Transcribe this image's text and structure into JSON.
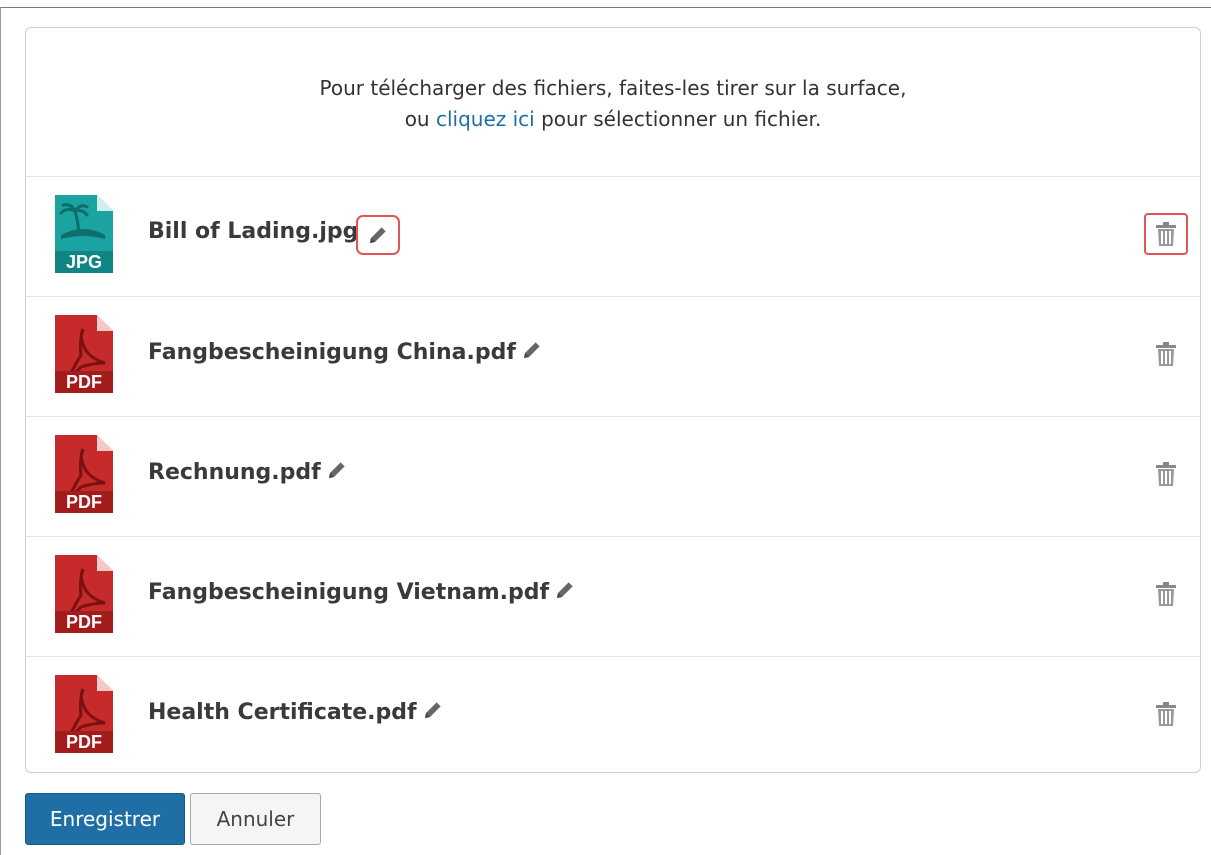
{
  "dropzone": {
    "line1": "Pour télécharger des fichiers, faites-les tirer sur la surface,",
    "line2_prefix": "ou ",
    "line2_link": "cliquez ici",
    "line2_suffix": " pour sélectionner un fichier."
  },
  "files": [
    {
      "name": "Bill of Lading.jpg",
      "type_label": "JPG",
      "icon": "jpg-file-icon",
      "highlighted": true
    },
    {
      "name": "Fangbescheinigung China.pdf",
      "type_label": "PDF",
      "icon": "pdf-file-icon",
      "highlighted": false
    },
    {
      "name": "Rechnung.pdf",
      "type_label": "PDF",
      "icon": "pdf-file-icon",
      "highlighted": false
    },
    {
      "name": "Fangbescheinigung Vietnam.pdf",
      "type_label": "PDF",
      "icon": "pdf-file-icon",
      "highlighted": false
    },
    {
      "name": "Health Certificate.pdf",
      "type_label": "PDF",
      "icon": "pdf-file-icon",
      "highlighted": false
    }
  ],
  "actions": {
    "save_label": "Enregistrer",
    "cancel_label": "Annuler"
  },
  "colors": {
    "accent": "#1f6fa6",
    "highlight": "#e05656",
    "pdf_red": "#c62a2a",
    "jpg_teal": "#1aa3a0"
  }
}
